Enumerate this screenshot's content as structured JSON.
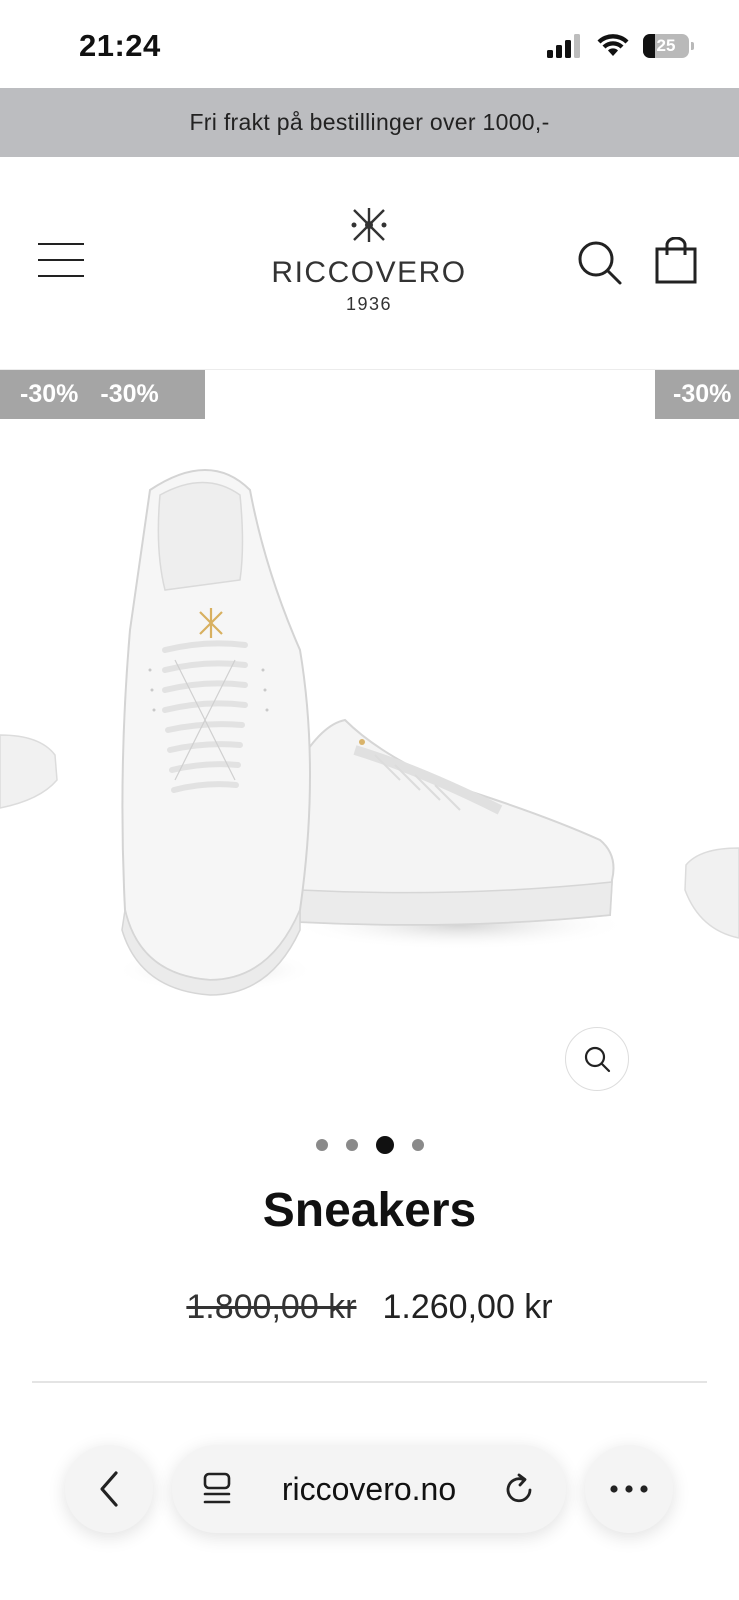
{
  "status_bar": {
    "time": "21:24",
    "battery": "25"
  },
  "promo": {
    "text": "Fri frakt på bestillinger over 1000,-"
  },
  "header": {
    "logo_name": "RICCOVERO",
    "logo_year": "1936"
  },
  "gallery": {
    "badges": [
      "-30%",
      "-30%",
      "-30%"
    ],
    "dots_count": 4,
    "active_dot": 3
  },
  "product": {
    "title": "Sneakers",
    "old_price": "1.800,00 kr",
    "price": "1.260,00 kr"
  },
  "browser": {
    "url": "riccovero.no"
  },
  "colors": {
    "banner": "#bcbdc0",
    "badge": "#a5a5a5",
    "text": "#111111"
  },
  "icons": [
    "signal-icon",
    "wifi-icon",
    "battery-icon",
    "menu-icon",
    "logo-mark-icon",
    "search-icon",
    "bag-icon",
    "zoom-icon",
    "back-icon",
    "tabs-icon",
    "reload-icon",
    "more-icon"
  ]
}
